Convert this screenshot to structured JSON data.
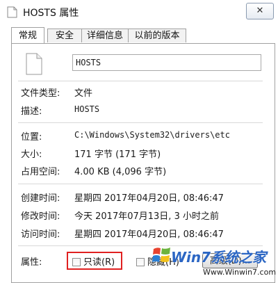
{
  "window": {
    "title": "HOSTS 属性",
    "close_glyph": "✕"
  },
  "tabs": [
    {
      "label": "常规",
      "active": true
    },
    {
      "label": "安全",
      "active": false
    },
    {
      "label": "详细信息",
      "active": false
    },
    {
      "label": "以前的版本",
      "active": false
    }
  ],
  "general": {
    "file_name": "HOSTS",
    "file_type": {
      "label": "文件类型:",
      "value": "文件"
    },
    "description": {
      "label": "描述:",
      "value": "HOSTS"
    },
    "location": {
      "label": "位置:",
      "value": "C:\\Windows\\System32\\drivers\\etc"
    },
    "size": {
      "label": "大小:",
      "value": "171 字节 (171 字节)"
    },
    "size_on_disk": {
      "label": "占用空间:",
      "value": "4.00 KB (4,096 字节)"
    },
    "created": {
      "label": "创建时间:",
      "value": "星期四 2017年04月20日, 08:46:47"
    },
    "modified": {
      "label": "修改时间:",
      "value": "今天 2017年07月13日, 3 小时之前"
    },
    "accessed": {
      "label": "访问时间:",
      "value": "星期四 2017年04月20日, 08:46:47"
    },
    "attributes": {
      "label": "属性:",
      "readonly": {
        "label": "只读(R)",
        "checked": false
      },
      "hidden": {
        "label": "隐藏(H)",
        "checked": false
      },
      "advanced_button": "高级(D)..."
    }
  },
  "watermark": {
    "title": "Win7系统之家",
    "url": "Www.Winwin7.com"
  },
  "colors": {
    "highlight": "#e02020",
    "watermark": "#2b66c4"
  },
  "icons": {
    "title_icon": "file-icon",
    "large_icon": "file-icon",
    "close": "close-icon"
  }
}
